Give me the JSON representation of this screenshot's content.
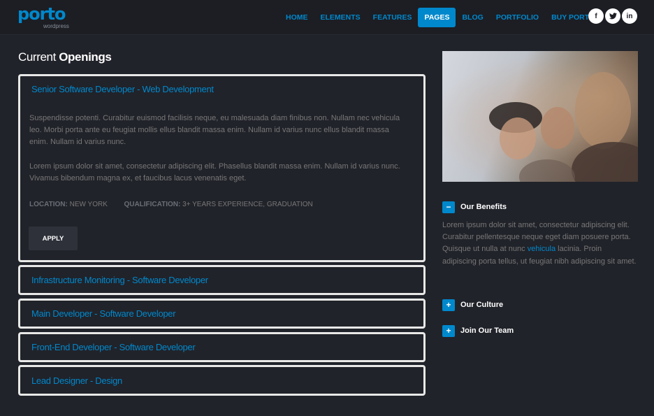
{
  "brand": {
    "name": "porto",
    "tagline": "wordpress",
    "accent": "#0088cc"
  },
  "nav": {
    "items": [
      {
        "label": "HOME",
        "active": false
      },
      {
        "label": "ELEMENTS",
        "active": false
      },
      {
        "label": "FEATURES",
        "active": false
      },
      {
        "label": "PAGES",
        "active": true
      },
      {
        "label": "BLOG",
        "active": false
      },
      {
        "label": "PORTFOLIO",
        "active": false
      },
      {
        "label": "BUY PORTO!",
        "active": false
      }
    ],
    "social": [
      {
        "icon": "facebook-icon",
        "glyph": "f"
      },
      {
        "icon": "twitter-icon",
        "glyph": "t"
      },
      {
        "icon": "linkedin-icon",
        "glyph": "in"
      }
    ]
  },
  "main": {
    "title_light": "Current ",
    "title_bold": "Openings",
    "jobs": [
      {
        "title": "Senior Software Developer - Web Development",
        "expanded": true,
        "description": [
          "Suspendisse potenti. Curabitur euismod facilisis neque, eu malesuada diam finibus non. Nullam nec vehicula leo. Morbi porta ante eu feugiat mollis ellus blandit massa enim. Nullam id varius nunc ellus blandit massa enim. Nullam id varius nunc.",
          "Lorem ipsum dolor sit amet, consectetur adipiscing elit. Phasellus blandit massa enim. Nullam id varius nunc. Vivamus bibendum magna ex, et faucibus lacus venenatis eget."
        ],
        "location_label": "LOCATION:",
        "location_value": "NEW YORK",
        "qualification_label": "QUALIFICATION:",
        "qualification_value": "3+ YEARS EXPERIENCE, GRADUATION",
        "apply_label": "APPLY"
      },
      {
        "title": "Infrastructure Monitoring - Software Developer",
        "expanded": false
      },
      {
        "title": "Main Developer - Software Developer",
        "expanded": false
      },
      {
        "title": "Front-End Developer - Software Developer",
        "expanded": false
      },
      {
        "title": "Lead Designer - Design",
        "expanded": false
      }
    ]
  },
  "sidebar": {
    "accordion": [
      {
        "label": "Our Benefits",
        "toggle": "−",
        "expanded": true,
        "body_before_link": "Lorem ipsum dolor sit amet, consectetur adipiscing elit. Curabitur pellentesque neque eget diam posuere porta. Quisque ut nulla at nunc ",
        "body_link": "vehicula",
        "body_after_link": " lacinia. Proin adipiscing porta tellus, ut feugiat nibh adipiscing sit amet."
      },
      {
        "label": "Our Culture",
        "toggle": "+",
        "expanded": false
      },
      {
        "label": "Join Our Team",
        "toggle": "+",
        "expanded": false
      }
    ]
  }
}
